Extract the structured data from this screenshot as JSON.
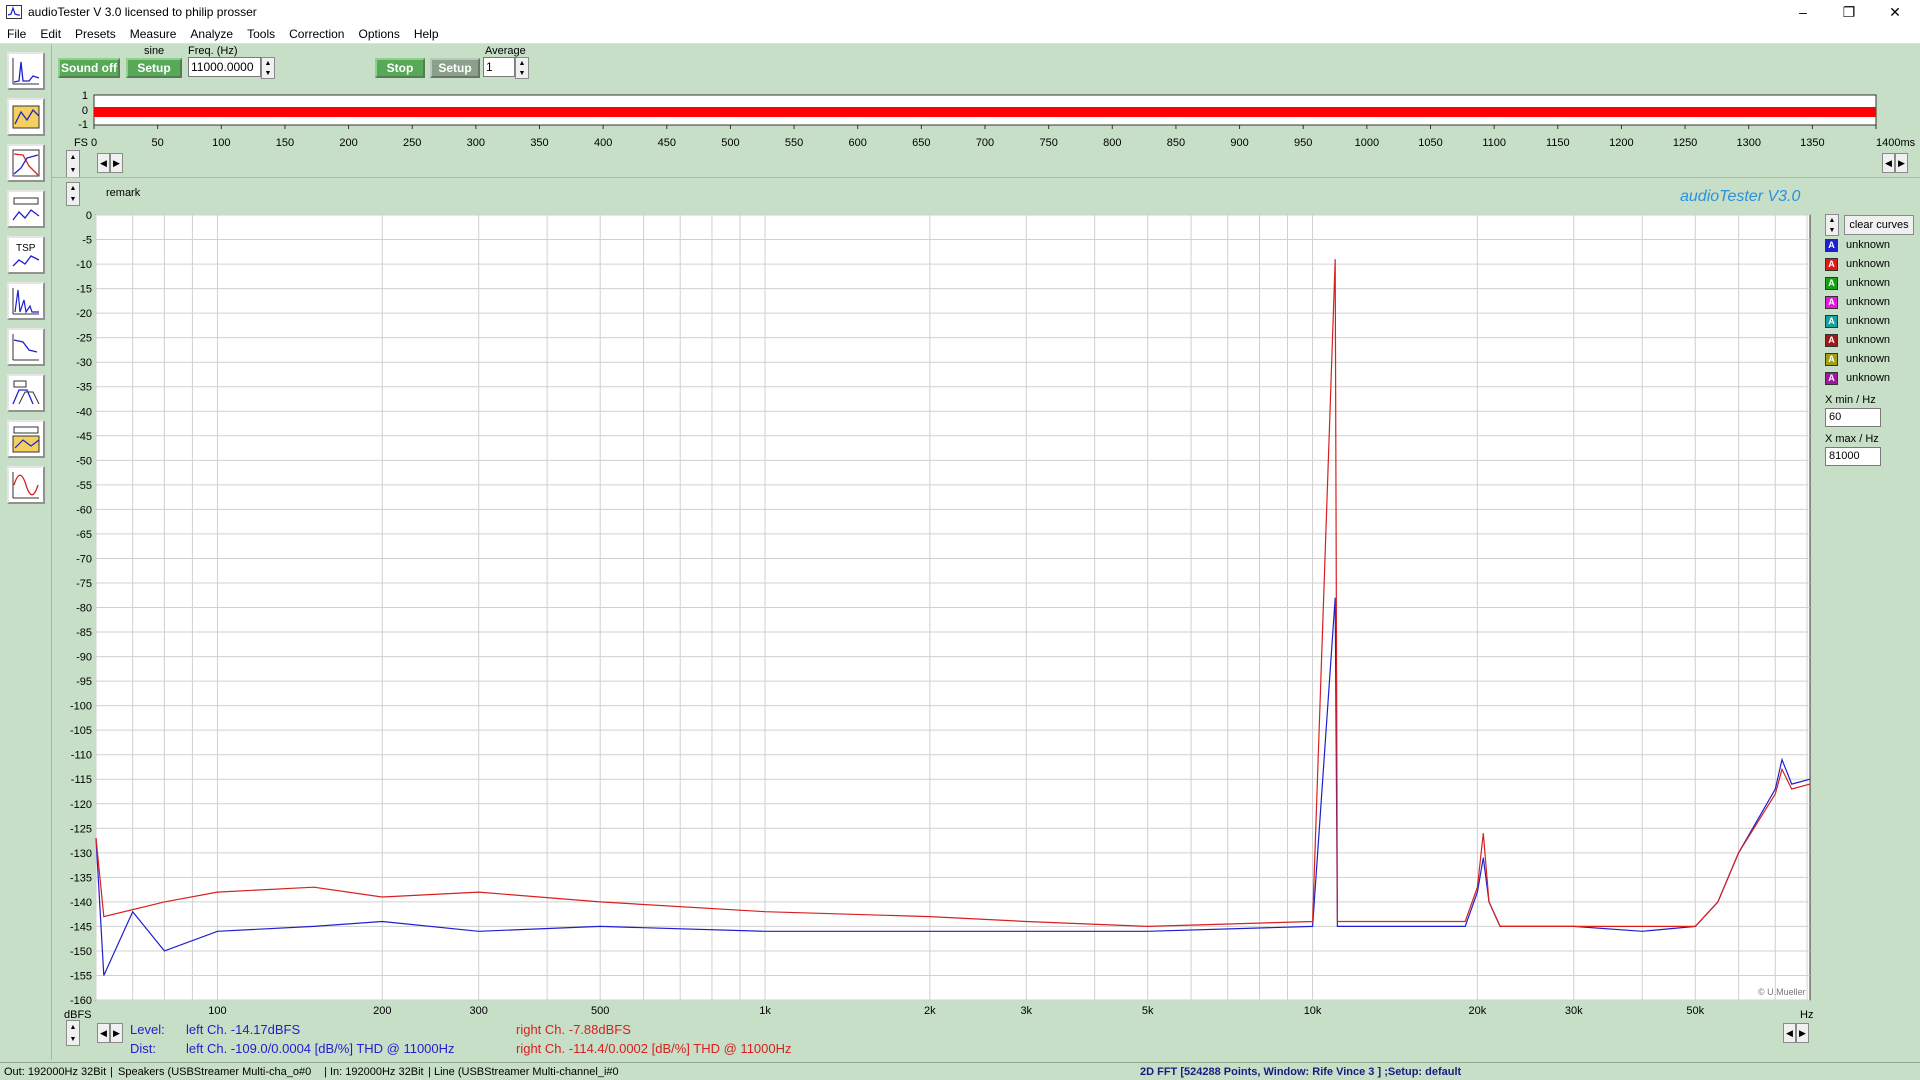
{
  "window": {
    "title": "audioTester  V 3.0   licensed to philip prosser"
  },
  "menu": [
    "File",
    "Edit",
    "Presets",
    "Measure",
    "Analyze",
    "Tools",
    "Correction",
    "Options",
    "Help"
  ],
  "generator": {
    "sound_button": "Sound off",
    "waveform_label": "sine",
    "setup_button": "Setup",
    "freq_label": "Freq. (Hz)",
    "freq_value": "11000.0000"
  },
  "analyzer": {
    "stop_button": "Stop",
    "setup_button": "Setup",
    "average_label": "Average",
    "average_value": "1"
  },
  "time_view": {
    "y_labels": [
      "1",
      "0",
      "-1"
    ],
    "fs_label": "FS",
    "x_labels": [
      "0",
      "50",
      "100",
      "150",
      "200",
      "250",
      "300",
      "350",
      "400",
      "450",
      "500",
      "550",
      "600",
      "650",
      "700",
      "750",
      "800",
      "850",
      "900",
      "950",
      "1000",
      "1050",
      "1100",
      "1150",
      "1200",
      "1250",
      "1300",
      "1350",
      "1400ms"
    ]
  },
  "remark_label": "remark",
  "watermark": "audioTester  V3.0",
  "credit": "© U.Mueller",
  "chart_data": {
    "type": "line",
    "xscale": "log",
    "xlim": [
      60,
      81000
    ],
    "ylim": [
      -160,
      0
    ],
    "ylabel": "dBFS",
    "xlabel": "Hz",
    "x_tick_labels": [
      {
        "v": 100,
        "t": "100"
      },
      {
        "v": 200,
        "t": "200"
      },
      {
        "v": 300,
        "t": "300"
      },
      {
        "v": 500,
        "t": "500"
      },
      {
        "v": 1000,
        "t": "1k"
      },
      {
        "v": 2000,
        "t": "2k"
      },
      {
        "v": 3000,
        "t": "3k"
      },
      {
        "v": 5000,
        "t": "5k"
      },
      {
        "v": 10000,
        "t": "10k"
      },
      {
        "v": 20000,
        "t": "20k"
      },
      {
        "v": 30000,
        "t": "30k"
      },
      {
        "v": 50000,
        "t": "50k"
      }
    ],
    "y_tick_labels": [
      "0",
      "-5",
      "-10",
      "-15",
      "-20",
      "-25",
      "-30",
      "-35",
      "-40",
      "-45",
      "-50",
      "-55",
      "-60",
      "-65",
      "-70",
      "-75",
      "-80",
      "-85",
      "-90",
      "-95",
      "-100",
      "-105",
      "-110",
      "-115",
      "-120",
      "-125",
      "-130",
      "-135",
      "-140",
      "-145",
      "-150",
      "-155",
      "-160"
    ],
    "grid": true,
    "series": [
      {
        "name": "left",
        "color": "#1f1fd0",
        "points": [
          [
            60,
            -127
          ],
          [
            62,
            -155
          ],
          [
            70,
            -142
          ],
          [
            80,
            -150
          ],
          [
            100,
            -146
          ],
          [
            150,
            -145
          ],
          [
            200,
            -144
          ],
          [
            300,
            -146
          ],
          [
            500,
            -145
          ],
          [
            1000,
            -146
          ],
          [
            2000,
            -146
          ],
          [
            3000,
            -146
          ],
          [
            5000,
            -146
          ],
          [
            10000,
            -145
          ],
          [
            11000,
            -78
          ],
          [
            11100,
            -145
          ],
          [
            15000,
            -145
          ],
          [
            19000,
            -145
          ],
          [
            20000,
            -138
          ],
          [
            20500,
            -131
          ],
          [
            21000,
            -140
          ],
          [
            22000,
            -145
          ],
          [
            30000,
            -145
          ],
          [
            40000,
            -146
          ],
          [
            50000,
            -145
          ],
          [
            55000,
            -140
          ],
          [
            60000,
            -130
          ],
          [
            70000,
            -117
          ],
          [
            72000,
            -111
          ],
          [
            75000,
            -116
          ],
          [
            81000,
            -115
          ]
        ]
      },
      {
        "name": "right",
        "color": "#d82020",
        "points": [
          [
            60,
            -127
          ],
          [
            62,
            -143
          ],
          [
            80,
            -140
          ],
          [
            100,
            -138
          ],
          [
            150,
            -137
          ],
          [
            200,
            -139
          ],
          [
            300,
            -138
          ],
          [
            500,
            -140
          ],
          [
            1000,
            -142
          ],
          [
            2000,
            -143
          ],
          [
            3000,
            -144
          ],
          [
            5000,
            -145
          ],
          [
            10000,
            -144
          ],
          [
            11000,
            -9
          ],
          [
            11100,
            -144
          ],
          [
            15000,
            -144
          ],
          [
            19000,
            -144
          ],
          [
            20000,
            -137
          ],
          [
            20500,
            -126
          ],
          [
            21000,
            -140
          ],
          [
            22000,
            -145
          ],
          [
            30000,
            -145
          ],
          [
            40000,
            -145
          ],
          [
            50000,
            -145
          ],
          [
            55000,
            -140
          ],
          [
            60000,
            -130
          ],
          [
            70000,
            -118
          ],
          [
            72000,
            -113
          ],
          [
            75000,
            -117
          ],
          [
            81000,
            -116
          ]
        ]
      }
    ]
  },
  "legend": {
    "clear_button": "clear curves",
    "items": [
      {
        "label": "unknown",
        "color": "#1f1fd0"
      },
      {
        "label": "unknown",
        "color": "#e01818"
      },
      {
        "label": "unknown",
        "color": "#18a018"
      },
      {
        "label": "unknown",
        "color": "#e018e0"
      },
      {
        "label": "unknown",
        "color": "#18a0a0"
      },
      {
        "label": "unknown",
        "color": "#a01818"
      },
      {
        "label": "unknown",
        "color": "#a0a018"
      },
      {
        "label": "unknown",
        "color": "#a018a0"
      }
    ],
    "icon_glyph": "A",
    "xmin_label": "X min / Hz",
    "xmin_value": "60",
    "xmax_label": "X max / Hz",
    "xmax_value": "81000"
  },
  "readout": {
    "level_label": "Level:",
    "dist_label": "Dist:",
    "level_left": "left Ch. -14.17dBFS",
    "level_right": "right Ch. -7.88dBFS",
    "dist_left": "left Ch. -109.0/0.0004 [dB/%] THD @ 11000Hz",
    "dist_right": "right Ch. -114.4/0.0002 [dB/%] THD @ 11000Hz"
  },
  "status": {
    "out": "Out: 192000Hz 32Bit",
    "speakers": "Speakers (USBStreamer Multi-cha_o#0",
    "in": "In: 192000Hz 32Bit",
    "line": "Line (USBStreamer Multi-channel_i#0",
    "fft": "2D FFT [524288 Points, Window: Rife Vince 3 ] ;Setup:  default"
  }
}
